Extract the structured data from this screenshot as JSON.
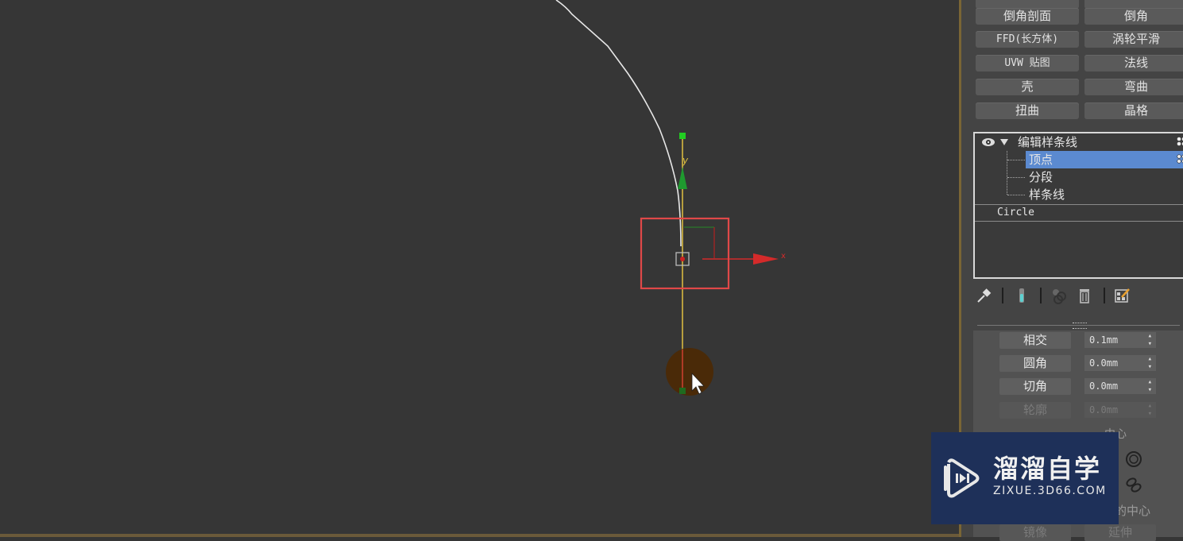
{
  "viewport": {
    "gizmo_axis_x_label": "x",
    "gizmo_axis_y_label": "y",
    "colors": {
      "background": "#363636",
      "spline": "#e8e8e8",
      "y_axis_line": "#e0c040",
      "y_arrow": "#1f9a2f",
      "x_arrow": "#d42a2a",
      "selection_box": "#e04848",
      "vertex_marker": "#cc2222",
      "cursor_halo": "#4a2a08"
    }
  },
  "modifier_buttons": [
    {
      "label": "倒角剖面"
    },
    {
      "label": "倒角"
    },
    {
      "label": "FFD(长方体)"
    },
    {
      "label": "涡轮平滑"
    },
    {
      "label": "UVW 贴图"
    },
    {
      "label": "法线"
    },
    {
      "label": "壳"
    },
    {
      "label": "弯曲"
    },
    {
      "label": "扭曲"
    },
    {
      "label": "晶格"
    }
  ],
  "modifier_stack": {
    "modifier": {
      "label": "编辑样条线",
      "expanded": true,
      "visible": true
    },
    "sub_objects": [
      {
        "label": "顶点",
        "selected": true
      },
      {
        "label": "分段",
        "selected": false
      },
      {
        "label": "样条线",
        "selected": false
      }
    ],
    "base_object": "Circle",
    "selection_color": "#5b8ad0"
  },
  "stack_toolbar": {
    "icons": [
      "pin-stack-icon",
      "show-end-result-icon",
      "make-unique-icon",
      "remove-modifier-icon",
      "configure-modifier-sets-icon"
    ]
  },
  "geometry_ops": [
    {
      "label": "相交",
      "value": "0.1mm",
      "enabled": true
    },
    {
      "label": "圆角",
      "value": "0.0mm",
      "enabled": true
    },
    {
      "label": "切角",
      "value": "0.0mm",
      "enabled": true
    },
    {
      "label": "轮廓",
      "value": "0.0mm",
      "enabled": false
    }
  ],
  "partially_hidden": {
    "checkbox_label_fragment": "中心",
    "center_label_fragment": "的中心",
    "bottom_button_left": "镜像",
    "bottom_button_right": "延伸"
  },
  "watermark": {
    "title": "溜溜自学",
    "url": "ZIXUE.3D66.COM",
    "background": "#1e3059"
  }
}
